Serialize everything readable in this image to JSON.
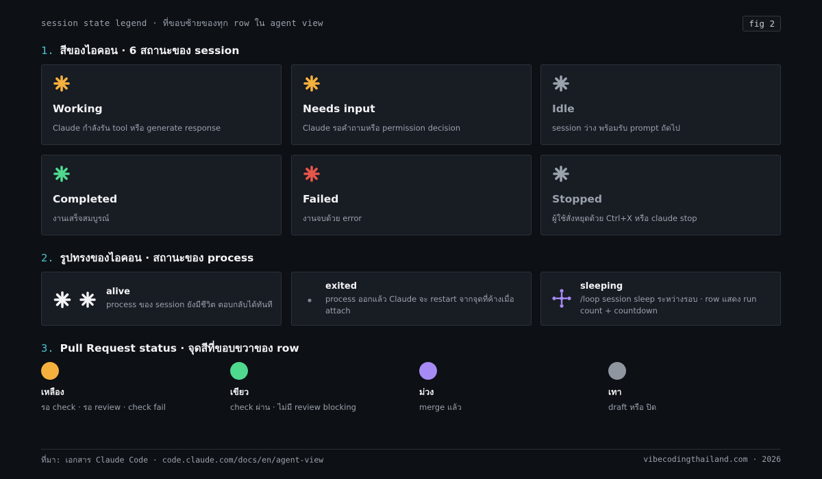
{
  "header": {
    "title": "session state legend · ที่ขอบซ้ายของทุก row ใน agent view",
    "fig": "fig 2"
  },
  "sections": [
    {
      "num": "1.",
      "title": "สีของไอคอน · 6 สถานะของ session"
    },
    {
      "num": "2.",
      "title": "รูปทรงของไอคอน · สถานะของ process"
    },
    {
      "num": "3.",
      "title": "Pull Request status · จุดสีที่ขอบขวาของ row"
    }
  ],
  "states": [
    {
      "name": "Working",
      "desc": "Claude กำลังรัน tool หรือ generate response",
      "color": "#f5b13d",
      "name_color": "#f2f3f5",
      "icon": "asterisk-icon"
    },
    {
      "name": "Needs input",
      "desc": "Claude รอคำถามหรือ permission decision",
      "color": "#f5b13d",
      "name_color": "#f2f3f5",
      "icon": "asterisk-icon"
    },
    {
      "name": "Idle",
      "desc": "session ว่าง พร้อมรับ prompt ถัดไป",
      "color": "#9aa2ad",
      "name_color": "#9aa2ad",
      "icon": "asterisk-icon"
    },
    {
      "name": "Completed",
      "desc": "งานเสร็จสมบูรณ์",
      "color": "#4fd98f",
      "name_color": "#f2f3f5",
      "icon": "asterisk-icon"
    },
    {
      "name": "Failed",
      "desc": "งานจบด้วย error",
      "color": "#e8564a",
      "name_color": "#f2f3f5",
      "icon": "asterisk-icon"
    },
    {
      "name": "Stopped",
      "desc": "ผู้ใช้สั่งหยุดด้วย Ctrl+X หรือ claude stop",
      "color": "#9aa2ad",
      "name_color": "#9aa2ad",
      "icon": "asterisk-icon"
    }
  ],
  "processes": [
    {
      "name": "alive",
      "desc": "process ของ session ยังมีชีวิต ตอบกลับได้ทันที",
      "icon": "asterisk-pulse-icon",
      "color": "#f2f3f5"
    },
    {
      "name": "exited",
      "desc": "process ออกแล้ว Claude จะ restart จากจุดที่ค้างเมื่อ attach",
      "icon": "dot-icon",
      "color": "#7c8590"
    },
    {
      "name": "sleeping",
      "desc": "/loop session sleep ระหว่างรอบ · row แสดง run count + countdown",
      "icon": "sparkle-icon",
      "color": "#a68bf5"
    }
  ],
  "pr_status": [
    {
      "name": "เหลือง",
      "desc": "รอ check · รอ review · check fail",
      "color": "#f5b13d"
    },
    {
      "name": "เขียว",
      "desc": "check ผ่าน · ไม่มี review blocking",
      "color": "#4fd98f"
    },
    {
      "name": "ม่วง",
      "desc": "merge แล้ว",
      "color": "#a68bf5"
    },
    {
      "name": "เทา",
      "desc": "draft หรือ ปิด",
      "color": "#8f96a0"
    }
  ],
  "footer": {
    "source": "ที่มา: เอกสาร Claude Code · code.claude.com/docs/en/agent-view",
    "credit": "vibecodingthailand.com · 2026"
  }
}
